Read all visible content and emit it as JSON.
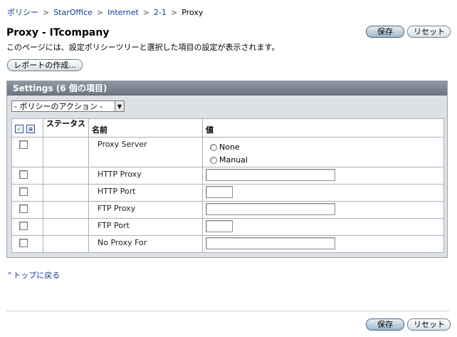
{
  "breadcrumb": {
    "items": [
      "ポリシー",
      "StarOffice",
      "Internet",
      "2-1"
    ],
    "current": "Proxy",
    "separator": ">"
  },
  "page": {
    "title": "Proxy - ITcompany",
    "description": "このページには、設定ポリシーツリーと選択した項目の設定が表示されます。"
  },
  "buttons": {
    "save": "保存",
    "reset": "リセット",
    "create_report": "レポートの作成..."
  },
  "settings": {
    "header": "Settings (6 個の項目)",
    "action_select": "- ポリシーのアクション -",
    "columns": {
      "status": "ステータス",
      "name": "名前",
      "value": "値"
    },
    "rows": [
      {
        "name": "Proxy Server",
        "type": "radio",
        "options": [
          "None",
          "Manual"
        ]
      },
      {
        "name": "HTTP Proxy",
        "type": "text-wide"
      },
      {
        "name": "HTTP Port",
        "type": "text-narrow"
      },
      {
        "name": "FTP Proxy",
        "type": "text-wide"
      },
      {
        "name": "FTP Port",
        "type": "text-narrow"
      },
      {
        "name": "No Proxy For",
        "type": "text-wide"
      }
    ]
  },
  "links": {
    "back_to_top": "トップに戻る"
  },
  "colors": {
    "link": "#0a3d91",
    "header_bar": "#7c8793",
    "panel": "#dde1e5"
  }
}
